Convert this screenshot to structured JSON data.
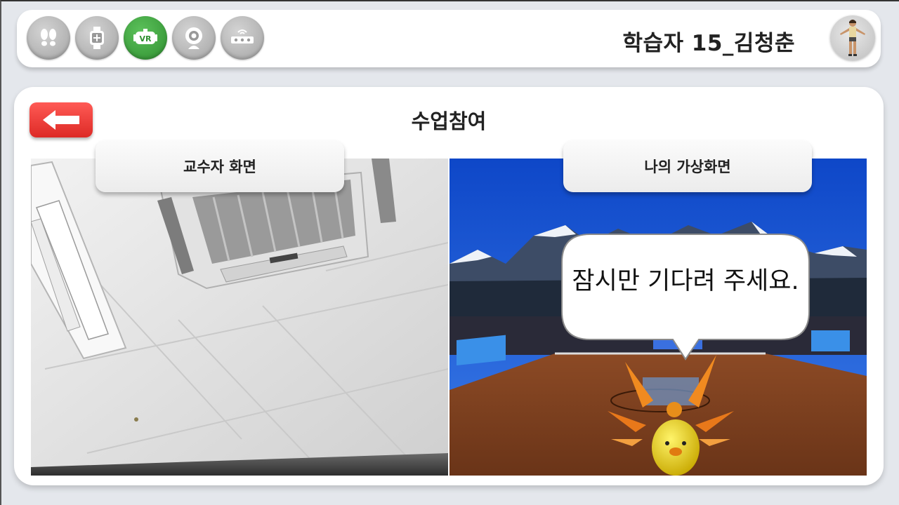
{
  "header": {
    "learner_name": "학습자 15_김청춘",
    "mode_icons": [
      {
        "name": "footprints-icon",
        "active": false
      },
      {
        "name": "smartwatch-icon",
        "active": false
      },
      {
        "name": "vr-headset-icon",
        "active": true,
        "label": "VR"
      },
      {
        "name": "webcam-icon",
        "active": false
      },
      {
        "name": "sensor-bar-icon",
        "active": false
      }
    ],
    "active_color": "#2f8f30",
    "inactive_color": "#a3a3a3"
  },
  "page": {
    "title": "수업참여",
    "back_color": "#e53430"
  },
  "screens": {
    "instructor_label": "교수자 화면",
    "my_virtual_label": "나의 가상화면",
    "speech_bubble": "잠시만 기다려 주세요."
  }
}
